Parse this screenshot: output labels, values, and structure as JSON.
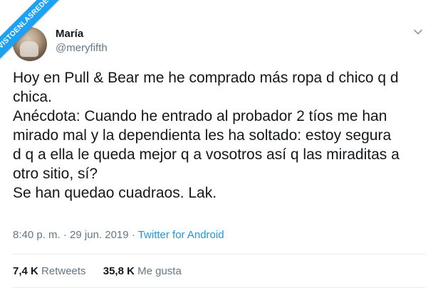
{
  "banner": {
    "text": "VISTOENLASREDES"
  },
  "user": {
    "name": "María",
    "handle": "@meryfifth"
  },
  "icons": {
    "menu": "chevron-down-icon",
    "avatar": "avatar-image"
  },
  "tweet": {
    "text": "Hoy en Pull & Bear me he comprado más ropa d chico q d\nchica.\nAnécdota: Cuando he entrado al probador 2 tíos me han\nmirado mal y la dependienta les ha soltado: estoy segura\nd q a ella le queda mejor q a vosotros así q las miraditas a\notro sitio, sí?\nSe han quedao cuadraos. Lak."
  },
  "meta": {
    "time": "8:40 p. m.",
    "separator1": " · ",
    "date": "29 jun. 2019",
    "separator2": " · ",
    "source": "Twitter for Android"
  },
  "stats": {
    "retweets_count": "7,4 K",
    "retweets_label": "Retweets",
    "likes_count": "35,8 K",
    "likes_label": "Me gusta"
  },
  "colors": {
    "link": "#1b95e0",
    "secondary_text": "#657786",
    "primary_text": "#14171a",
    "banner": "#1da1f2"
  }
}
